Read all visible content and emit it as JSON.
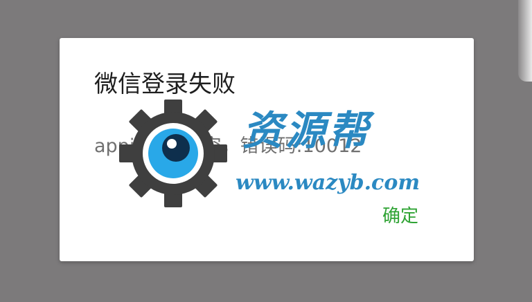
{
  "dialog": {
    "title": "微信登录失败",
    "message": "appid不能为空，错误码:10012",
    "confirm_label": "确定"
  },
  "watermark": {
    "brand_text": "资源帮",
    "url_text": "www.wazyb.com",
    "logo_icon": "gear-eye-icon"
  },
  "colors": {
    "scrim": "#7c7a7b",
    "dialog_bg": "#ffffff",
    "title": "#1e1e1e",
    "message": "#707070",
    "confirm": "#2fa334",
    "watermark_blue": "#2b89c2",
    "watermark_gear": "#3f3f3f",
    "watermark_eye": "#29a8e8"
  }
}
